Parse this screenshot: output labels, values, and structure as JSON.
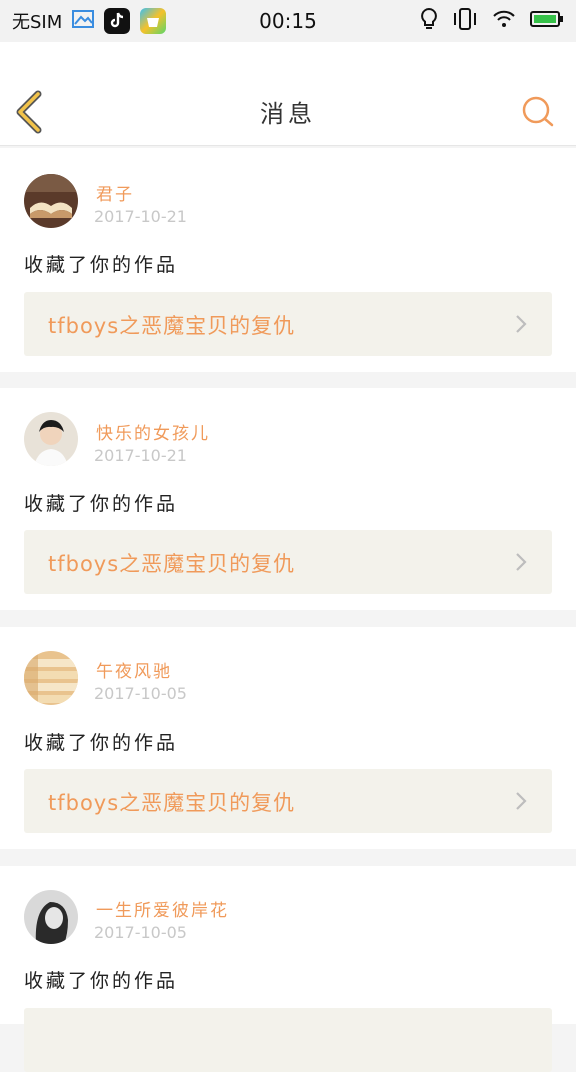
{
  "status_bar": {
    "sim": "无SIM",
    "time": "00:15"
  },
  "header": {
    "title": "消息"
  },
  "messages": [
    {
      "user": "君子",
      "date": "2017-10-21",
      "action": "收藏了你的作品",
      "work": "tfboys之恶魔宝贝的复仇"
    },
    {
      "user": "快乐的女孩儿",
      "date": "2017-10-21",
      "action": "收藏了你的作品",
      "work": "tfboys之恶魔宝贝的复仇"
    },
    {
      "user": "午夜风驰",
      "date": "2017-10-05",
      "action": "收藏了你的作品",
      "work": "tfboys之恶魔宝贝的复仇"
    },
    {
      "user": "一生所爱彼岸花",
      "date": "2017-10-05",
      "action": "收藏了你的作品",
      "work": ""
    }
  ],
  "colors": {
    "accent": "#f09a5a",
    "back_icon": "#f2c34a",
    "card_bg": "#f3f2eb"
  }
}
